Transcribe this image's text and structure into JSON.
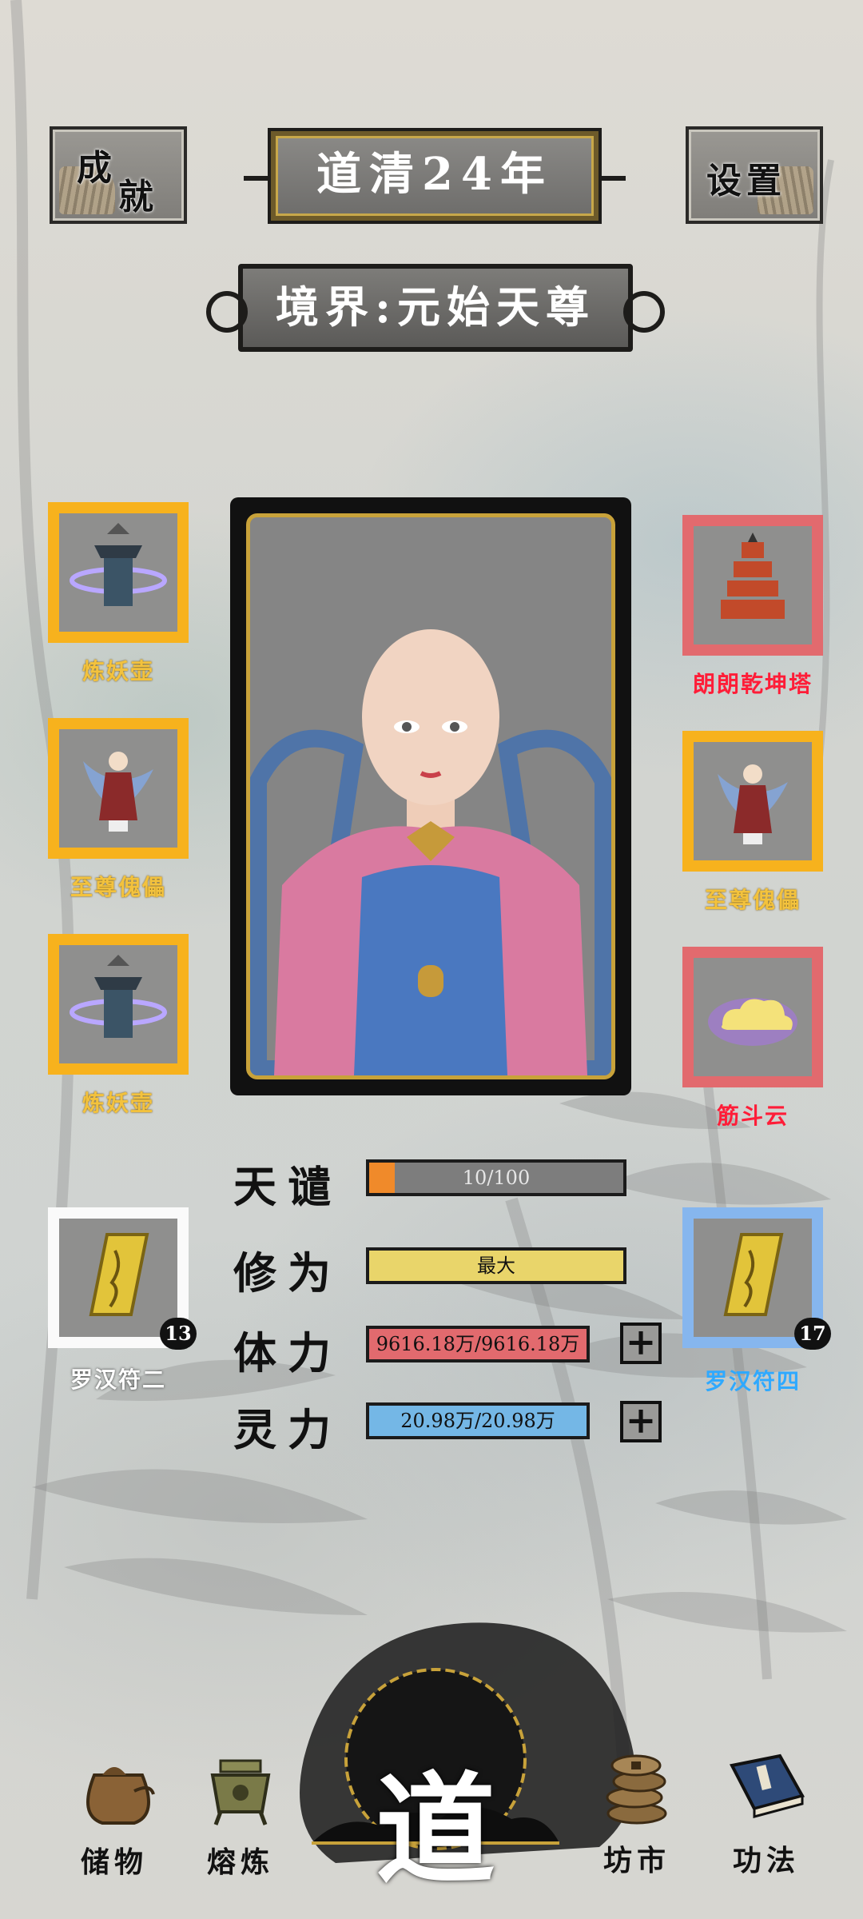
{
  "header": {
    "achievements_line1": "成",
    "achievements_line2": "就",
    "settings_label": "设置",
    "year": "道清24年",
    "realm": "境界:元始天尊"
  },
  "left_slots": [
    {
      "name": "炼妖壶",
      "rarity": "gold"
    },
    {
      "name": "至尊傀儡",
      "rarity": "gold"
    },
    {
      "name": "炼妖壶",
      "rarity": "gold"
    }
  ],
  "right_slots": [
    {
      "name": "朗朗乾坤塔",
      "rarity": "red"
    },
    {
      "name": "至尊傀儡",
      "rarity": "gold"
    },
    {
      "name": "筋斗云",
      "rarity": "red"
    }
  ],
  "talismans": {
    "left": {
      "name": "罗汉符二",
      "count": "13"
    },
    "right": {
      "name": "罗汉符四",
      "count": "17"
    }
  },
  "stats": {
    "tianqian": {
      "label": "天谴",
      "text": "10/100",
      "fraction": 0.1
    },
    "xiuwei": {
      "label": "修为",
      "text": "最大"
    },
    "tili": {
      "label": "体力",
      "text": "9616.18万/9616.18万"
    },
    "lingli": {
      "label": "灵力",
      "text": "20.98万/20.98万"
    },
    "plus": "+"
  },
  "nav": {
    "storage": "储物",
    "smelt": "熔炼",
    "dao": "道",
    "market": "坊市",
    "skills": "功法"
  },
  "colors": {
    "gold_border": "#f7b21d",
    "red_border": "#e26a6e",
    "gold_label": "#f3c23d",
    "red_label": "#ff1d38",
    "blue_label": "#2fa9ff"
  }
}
